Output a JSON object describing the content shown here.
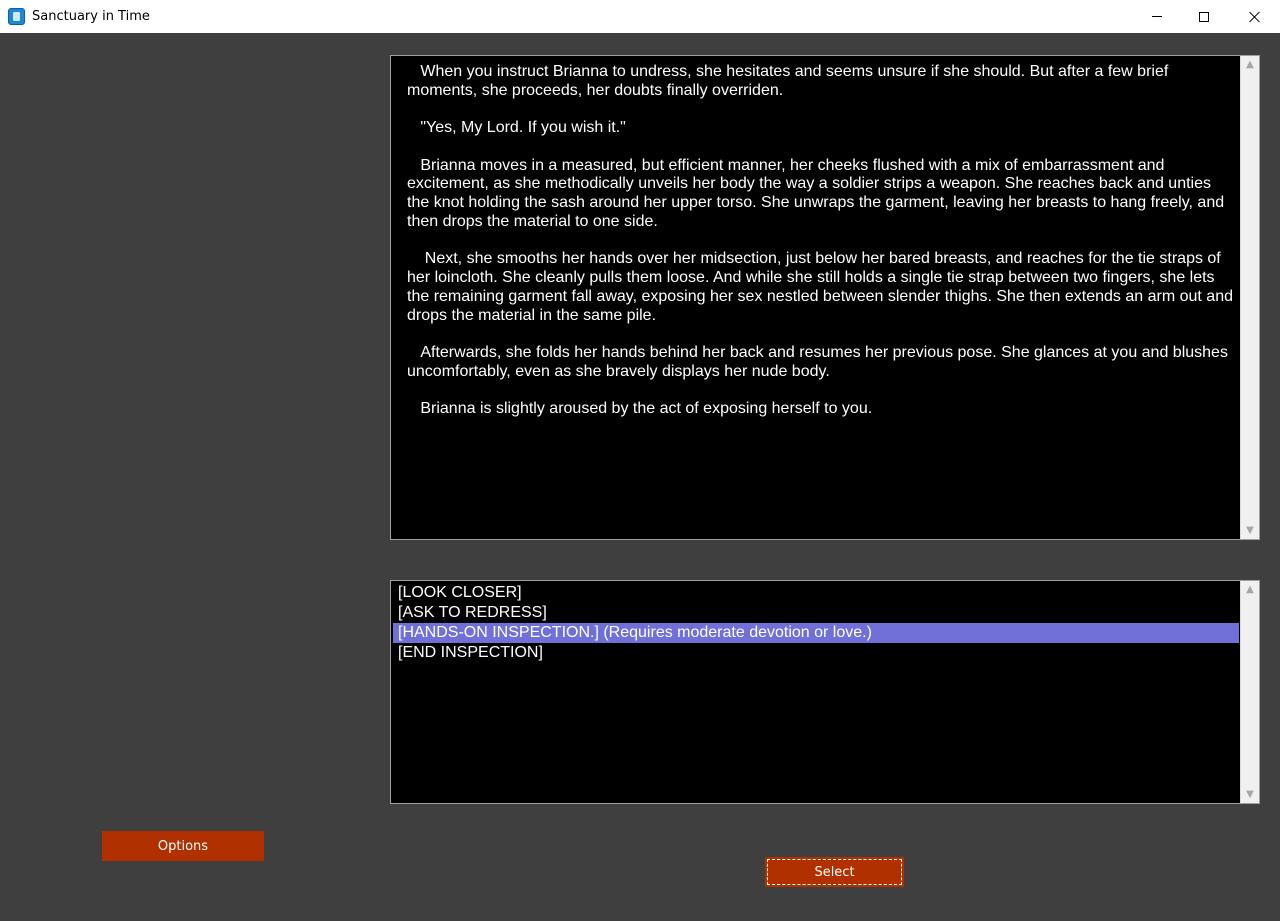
{
  "window": {
    "title": "Sanctuary in Time",
    "icon": "app-icon"
  },
  "narrative": {
    "paragraphs": [
      "   When you instruct Brianna to undress, she hesitates and seems unsure if she should. But after a few brief moments, she proceeds, her doubts finally overriden.",
      "   \"Yes, My Lord. If you wish it.\"",
      "   Brianna moves in a measured, but efficient manner, her cheeks flushed with a mix of embarrassment and excitement, as she methodically unveils her body the way a soldier strips a weapon. She reaches back and unties the knot holding the sash around her upper torso. She unwraps the garment, leaving her breasts to hang freely, and then drops the material to one side.",
      "    Next, she smooths her hands over her midsection, just below her bared breasts, and reaches for the tie straps of her loincloth. She cleanly pulls them loose. And while she still holds a single tie strap between two fingers, she lets the remaining garment fall away, exposing her sex nestled between slender thighs. She then extends an arm out and drops the material in the same pile.",
      "   Afterwards, she folds her hands behind her back and resumes her previous pose. She glances at you and blushes uncomfortably, even as she bravely displays her nude body.",
      "   Brianna is slightly aroused by the act of exposing herself to you."
    ]
  },
  "choices": {
    "items": [
      {
        "label": "[LOOK CLOSER]",
        "selected": false
      },
      {
        "label": "[ASK TO REDRESS]",
        "selected": false
      },
      {
        "label": "[HANDS-ON INSPECTION.] (Requires moderate devotion or love.)",
        "selected": true
      },
      {
        "label": "[END INSPECTION]",
        "selected": false
      }
    ]
  },
  "buttons": {
    "options_label": "Options",
    "select_label": "Select"
  },
  "colors": {
    "background": "#3f3f3f",
    "button": "#b03000",
    "selection": "#7070d8"
  }
}
